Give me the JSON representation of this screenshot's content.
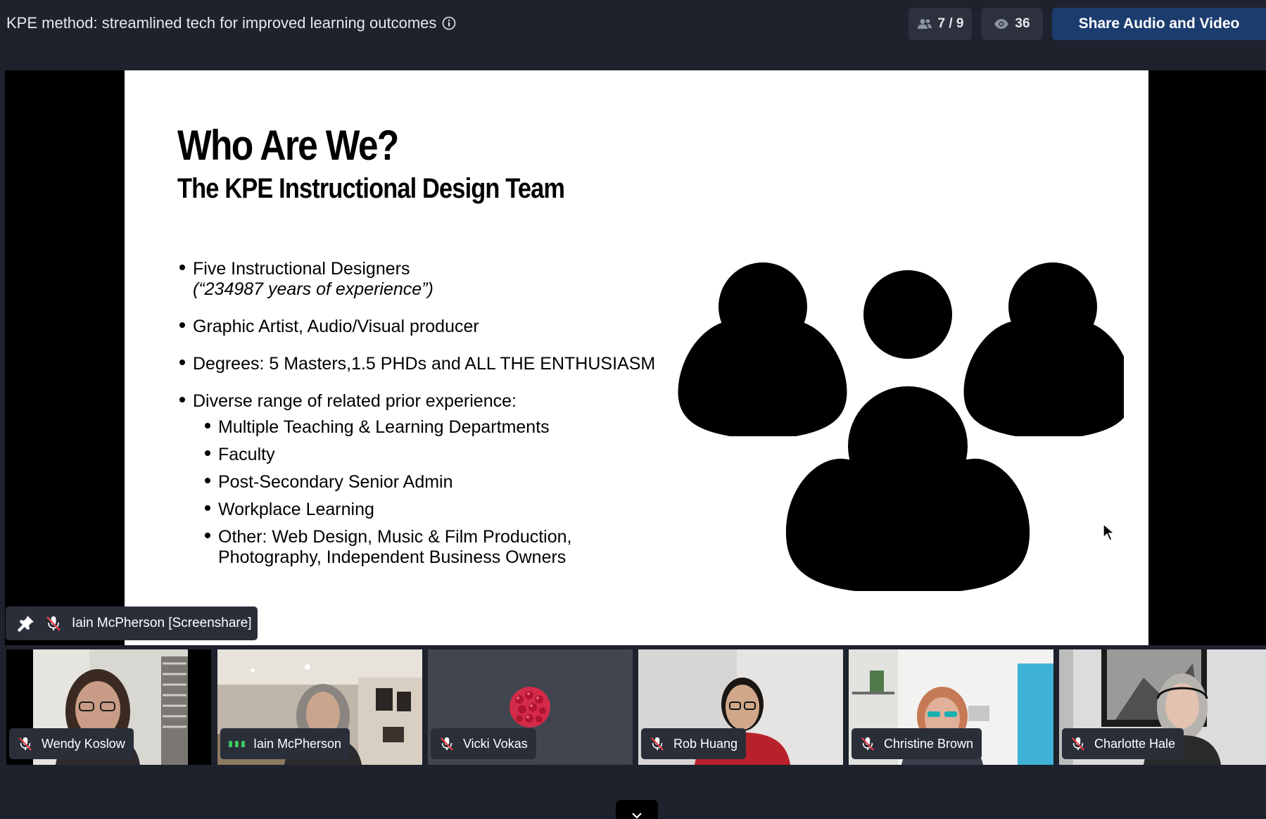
{
  "header": {
    "title": "KPE method: streamlined tech for improved learning outcomes",
    "participants_count": "7 / 9",
    "viewers_count": "36",
    "share_button": "Share Audio and Video"
  },
  "slide": {
    "title": "Who Are We?",
    "subtitle": "The KPE Instructional Design Team",
    "bullets": [
      {
        "text": "Five Instructional Designers",
        "sub": "(“234987 years of experience”)"
      },
      {
        "text": "Graphic Artist, Audio/Visual producer"
      },
      {
        "text": "Degrees: 5 Masters,1.5 PHDs and ALL THE ENTHUSIASM"
      },
      {
        "text": "Diverse range of related prior experience:"
      }
    ],
    "nested_bullets": [
      "Multiple Teaching & Learning Departments",
      "Faculty",
      "Post-Secondary Senior Admin",
      "Workplace Learning",
      "Other: Web Design, Music & Film Production, Photography, Independent Business Owners"
    ]
  },
  "screenshare": {
    "label": "Iain McPherson [Screenshare]"
  },
  "participants": [
    {
      "name": "Wendy Koslow",
      "muted": true
    },
    {
      "name": "Iain McPherson",
      "muted": false
    },
    {
      "name": "Vicki Vokas",
      "muted": true
    },
    {
      "name": "Rob Huang",
      "muted": true
    },
    {
      "name": "Christine Brown",
      "muted": true
    },
    {
      "name": "Charlotte Hale",
      "muted": true
    }
  ],
  "colors": {
    "background": "#1e222d",
    "share_button": "#1b3c6e",
    "speaking": "#3ec45d",
    "mute": "#e8424a"
  },
  "icons": {
    "participants": "people-icon",
    "viewers": "eye-icon",
    "pin": "pin-icon",
    "mute": "mic-muted-icon",
    "collapse": "chevron-down-icon"
  }
}
